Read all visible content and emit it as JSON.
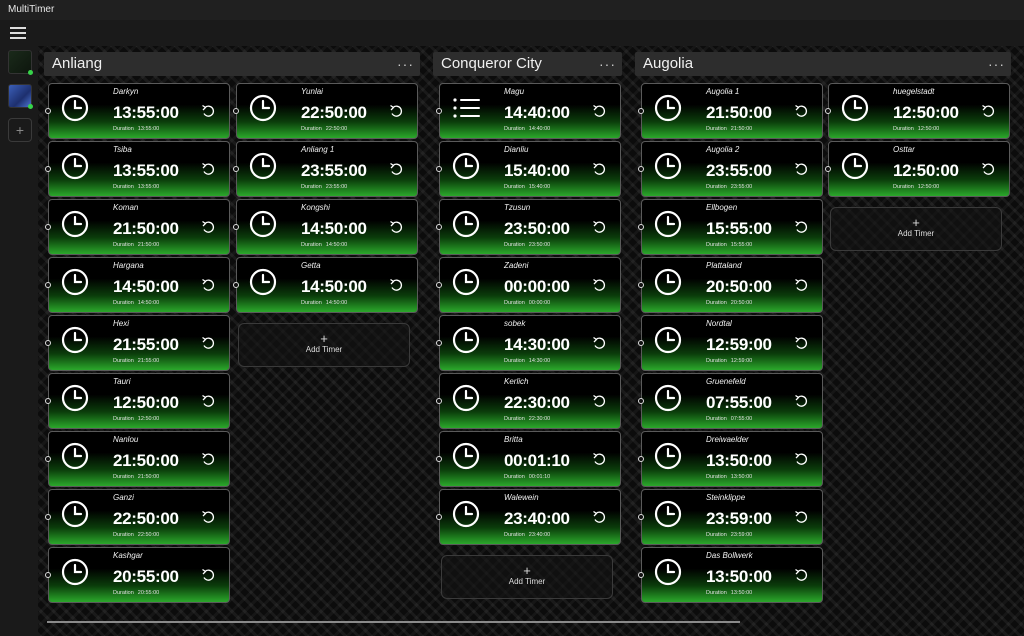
{
  "app": {
    "title": "MultiTimer"
  },
  "labels": {
    "duration": "Duration",
    "add_timer": "Add Timer",
    "more": "···",
    "add_plus": "+"
  },
  "colors": {
    "accent": "#2ba82b",
    "status_dot": "#37d44a"
  },
  "groups": [
    {
      "name": "Anliang",
      "timers": [
        {
          "name": "Darkyn",
          "time": "13:55:00",
          "duration": "13:55:00",
          "icon": "clock-icon"
        },
        {
          "name": "Tsiba",
          "time": "13:55:00",
          "duration": "13:55:00",
          "icon": "clock-icon"
        },
        {
          "name": "Koman",
          "time": "21:50:00",
          "duration": "21:50:00",
          "icon": "clock-icon"
        },
        {
          "name": "Hargana",
          "time": "14:50:00",
          "duration": "14:50:00",
          "icon": "clock-icon"
        },
        {
          "name": "Hexi",
          "time": "21:55:00",
          "duration": "21:55:00",
          "icon": "clock-icon"
        },
        {
          "name": "Tauri",
          "time": "12:50:00",
          "duration": "12:50:00",
          "icon": "clock-icon"
        },
        {
          "name": "Nanlou",
          "time": "21:50:00",
          "duration": "21:50:00",
          "icon": "clock-icon"
        },
        {
          "name": "Ganzi",
          "time": "22:50:00",
          "duration": "22:50:00",
          "icon": "clock-icon"
        },
        {
          "name": "Kashgar",
          "time": "20:55:00",
          "duration": "20:55:00",
          "icon": "clock-icon"
        },
        {
          "name": "Yunlai",
          "time": "22:50:00",
          "duration": "22:50:00",
          "icon": "clock-icon"
        },
        {
          "name": "Anliang 1",
          "time": "23:55:00",
          "duration": "23:55:00",
          "icon": "clock-icon"
        },
        {
          "name": "Kongshi",
          "time": "14:50:00",
          "duration": "14:50:00",
          "icon": "clock-icon"
        },
        {
          "name": "Getta",
          "time": "14:50:00",
          "duration": "14:50:00",
          "icon": "clock-icon"
        }
      ]
    },
    {
      "name": "Conqueror City",
      "timers": [
        {
          "name": "Magu",
          "time": "14:40:00",
          "duration": "14:40:00",
          "icon": "list-icon"
        },
        {
          "name": "Dianliu",
          "time": "15:40:00",
          "duration": "15:40:00",
          "icon": "clock-icon"
        },
        {
          "name": "Tzusun",
          "time": "23:50:00",
          "duration": "23:50:00",
          "icon": "clock-icon"
        },
        {
          "name": "Zadeni",
          "time": "00:00:00",
          "duration": "00:00:00",
          "icon": "clock-icon"
        },
        {
          "name": "sobek",
          "time": "14:30:00",
          "duration": "14:30:00",
          "icon": "clock-icon"
        },
        {
          "name": "Kerlich",
          "time": "22:30:00",
          "duration": "22:30:00",
          "icon": "clock-icon"
        },
        {
          "name": "Britta",
          "time": "00:01:10",
          "duration": "00:01:10",
          "icon": "clock-icon"
        },
        {
          "name": "Walewein",
          "time": "23:40:00",
          "duration": "23:40:00",
          "icon": "clock-icon"
        }
      ]
    },
    {
      "name": "Augolia",
      "timers": [
        {
          "name": "Augolia 1",
          "time": "21:50:00",
          "duration": "21:50:00",
          "icon": "clock-icon"
        },
        {
          "name": "Augolia 2",
          "time": "23:55:00",
          "duration": "23:55:00",
          "icon": "clock-icon"
        },
        {
          "name": "Ellbogen",
          "time": "15:55:00",
          "duration": "15:55:00",
          "icon": "clock-icon"
        },
        {
          "name": "Plattaland",
          "time": "20:50:00",
          "duration": "20:50:00",
          "icon": "clock-icon"
        },
        {
          "name": "Nordtal",
          "time": "12:59:00",
          "duration": "12:59:00",
          "icon": "clock-icon"
        },
        {
          "name": "Gruenefeld",
          "time": "07:55:00",
          "duration": "07:55:00",
          "icon": "clock-icon"
        },
        {
          "name": "Dreiwaelder",
          "time": "13:50:00",
          "duration": "13:50:00",
          "icon": "clock-icon"
        },
        {
          "name": "Steinklippe",
          "time": "23:59:00",
          "duration": "23:59:00",
          "icon": "clock-icon"
        },
        {
          "name": "Das Bollwerk",
          "time": "13:50:00",
          "duration": "13:50:00",
          "icon": "clock-icon"
        },
        {
          "name": "huegelstadt",
          "time": "12:50:00",
          "duration": "12:50:00",
          "icon": "clock-icon"
        },
        {
          "name": "Osttar",
          "time": "12:50:00",
          "duration": "12:50:00",
          "icon": "clock-icon"
        }
      ]
    }
  ]
}
